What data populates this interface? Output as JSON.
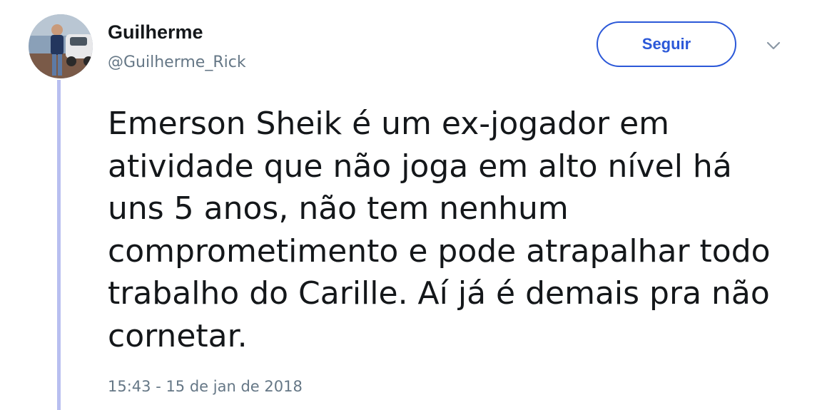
{
  "tweet": {
    "author": {
      "name": "Guilherme",
      "handle": "@Guilherme_Rick"
    },
    "follow_label": "Seguir",
    "menu_icon": "chevron-down-icon",
    "text": "Emerson Sheik é um ex-jogador em atividade que não joga em alto nível há uns 5 anos, não tem nenhum comprometimento e pode atrapalhar todo trabalho do Carille. Aí já é demais pra não cornetar.",
    "timestamp": "15:43 - 15 de jan de 2018"
  },
  "colors": {
    "accent": "#2b58d8",
    "thread_line": "#b8bff0",
    "text_primary": "#14171a",
    "text_secondary": "#657786"
  }
}
